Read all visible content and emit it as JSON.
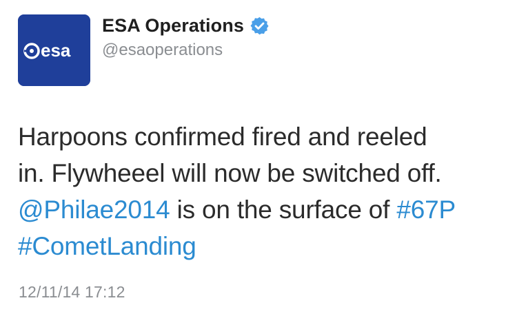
{
  "author": {
    "display_name": "ESA Operations",
    "handle": "@esaoperations",
    "verified": true,
    "avatar_icon": "esa-logo-icon",
    "avatar_text": "esa",
    "avatar_color": "#1f3f9a"
  },
  "tweet": {
    "line1": "Harpoons confirmed fired and reeled",
    "line2": "in. Flywheeel will now be switched off.",
    "mention": "@Philae2014",
    "line3_middle": " is on the surface of ",
    "hashtag_67p": "#67P",
    "hashtag_cometlanding": "#CometLanding",
    "timestamp": "12/11/14 17:12"
  },
  "colors": {
    "link": "#2b8bd1",
    "text": "#2b2b2b",
    "secondary": "#8a8d91",
    "verified_badge": "#4a9fe8"
  }
}
